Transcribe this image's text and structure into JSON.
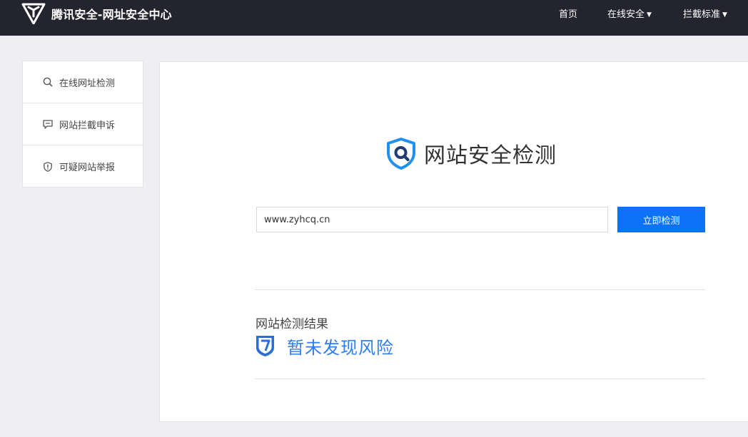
{
  "header": {
    "brand_title": "腾讯安全-网址安全中心",
    "nav": {
      "home": "首页",
      "online_security": "在线安全",
      "block_standard": "拦截标准"
    }
  },
  "sidebar": {
    "items": [
      {
        "label": "在线网址检测",
        "icon": "search-icon"
      },
      {
        "label": "网站拦截申诉",
        "icon": "comment-icon"
      },
      {
        "label": "可疑网站举报",
        "icon": "shield-alert-icon"
      }
    ]
  },
  "main": {
    "title": "网站安全检测",
    "search": {
      "value": "www.zyhcq.cn",
      "placeholder": ""
    },
    "check_button": "立即检测",
    "result": {
      "label": "网站检测结果",
      "status": "暂未发现风险"
    }
  },
  "colors": {
    "header_bg": "#23242e",
    "page_bg": "#efeff3",
    "accent": "#0c73f8",
    "result_text": "#2c7ef2"
  }
}
